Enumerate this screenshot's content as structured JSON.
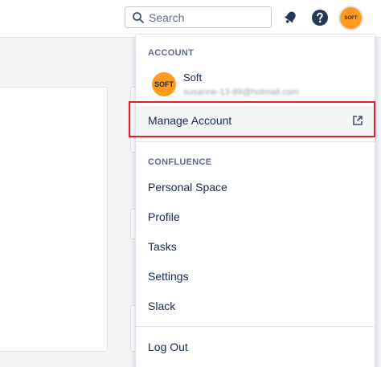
{
  "header": {
    "search_placeholder": "Search",
    "avatar_initials": "SOFT",
    "icons": [
      "search-icon",
      "notification-bell-icon",
      "help-icon"
    ]
  },
  "menu": {
    "account_section": "ACCOUNT",
    "profile": {
      "avatar_initials": "SOFT",
      "name": "Soft",
      "email": "susanne-13-89@hotmail.com"
    },
    "manage_account": "Manage Account",
    "confluence_section": "CONFLUENCE",
    "items": [
      {
        "label": "Personal Space"
      },
      {
        "label": "Profile"
      },
      {
        "label": "Tasks"
      },
      {
        "label": "Settings"
      },
      {
        "label": "Slack"
      }
    ],
    "log_out": "Log Out"
  },
  "colors": {
    "avatar": "#ff991f",
    "highlight_border": "#e01e2b",
    "text": "#172b4d",
    "muted": "#5e6c84"
  }
}
